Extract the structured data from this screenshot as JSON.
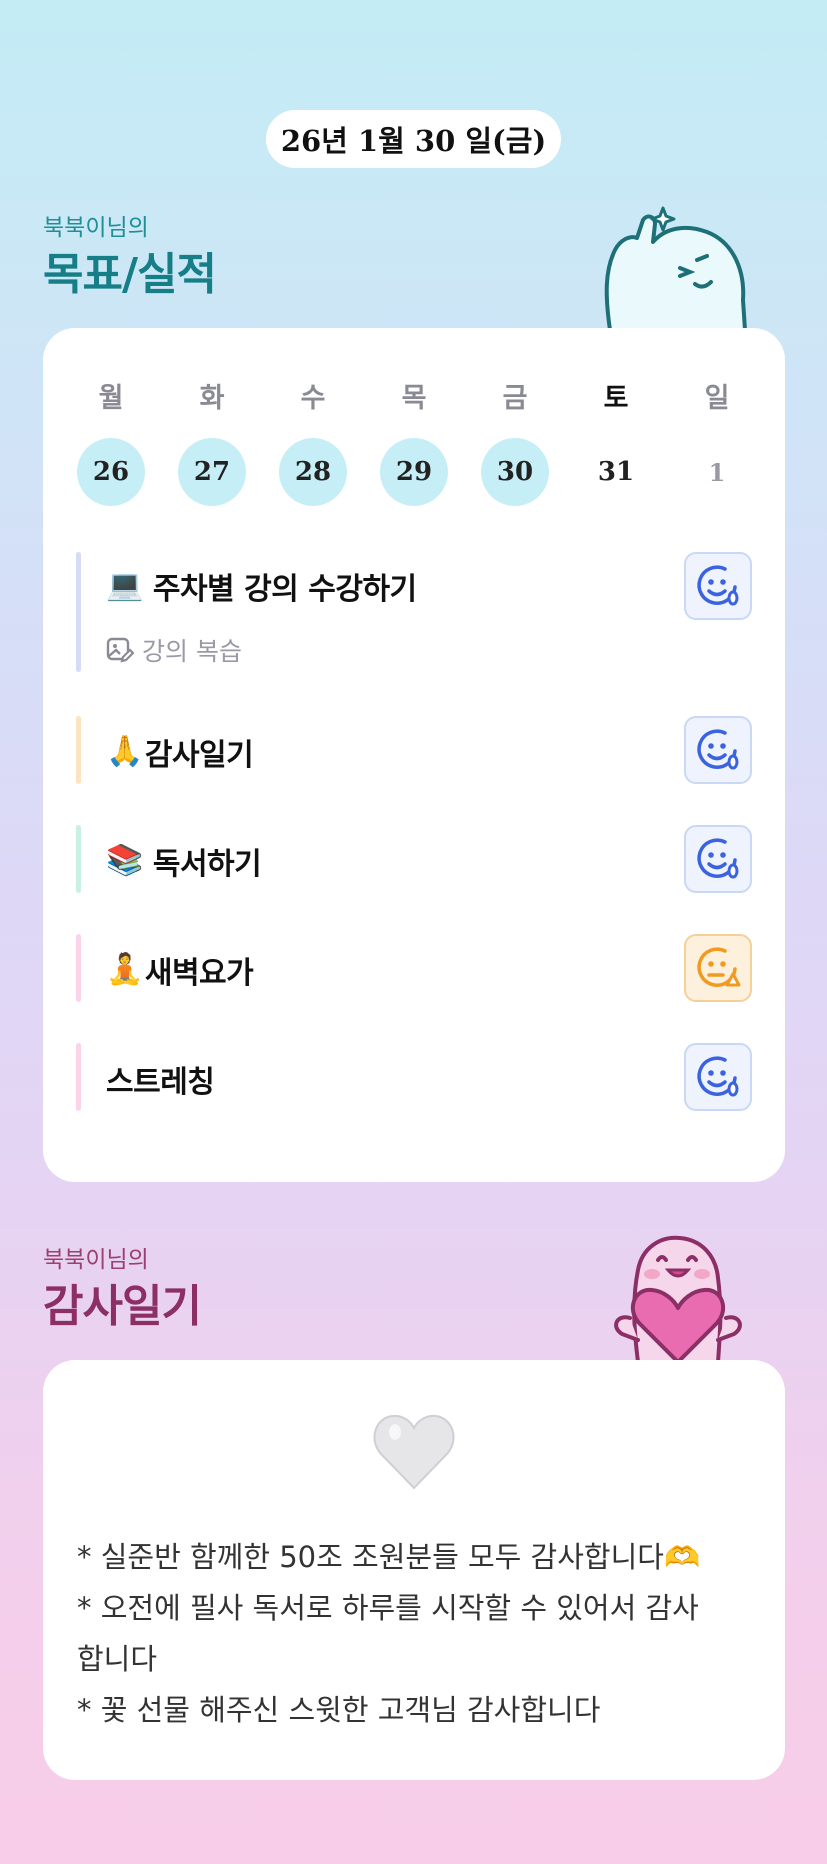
{
  "header": {
    "date": "26년 1월 30 일(금)"
  },
  "goals_section": {
    "owner": "북북이님의",
    "title": "목표/실적"
  },
  "week": {
    "labels": [
      "월",
      "화",
      "수",
      "목",
      "금",
      "토",
      "일"
    ],
    "dates": [
      "26",
      "27",
      "28",
      "29",
      "30",
      "31",
      "1"
    ],
    "done": [
      true,
      true,
      true,
      true,
      true,
      false,
      false
    ]
  },
  "goals": [
    {
      "emoji": "💻",
      "title": "주차별 강의 수강하기",
      "sub": "강의 복습",
      "bar_color": "#d4dcf6",
      "status": "smile-blue"
    },
    {
      "emoji": "🙏",
      "title": "감사일기",
      "bar_color": "#fde3bf",
      "status": "smile-blue"
    },
    {
      "emoji": "📚",
      "title": "독서하기",
      "bar_color": "#c8f0e4",
      "status": "smile-blue"
    },
    {
      "emoji": "🧘",
      "title": "새벽요가",
      "bar_color": "#fcd4ea",
      "status": "neutral-orange"
    },
    {
      "emoji": "",
      "title": "스트레칭",
      "bar_color": "#fcd4ea",
      "status": "smile-blue"
    }
  ],
  "diary_section": {
    "owner": "북북이님의",
    "title": "감사일기"
  },
  "diary": {
    "heart": "🤍",
    "lines": [
      "* 실준반 함께한 50조 조원분들 모두 감사합니다🫶",
      "* 오전에 필사 독서로 하루를 시작할 수 있어서 감사",
      "합니다",
      "* 꽃 선물 해주신 스윗한 고객님 감사합니다"
    ]
  },
  "colors": {
    "teal": "#1f8e95",
    "plum": "#9b3f72",
    "done_day": "#c6eef6",
    "face_blue": "#3b63e0",
    "face_orange": "#f29a1f"
  }
}
